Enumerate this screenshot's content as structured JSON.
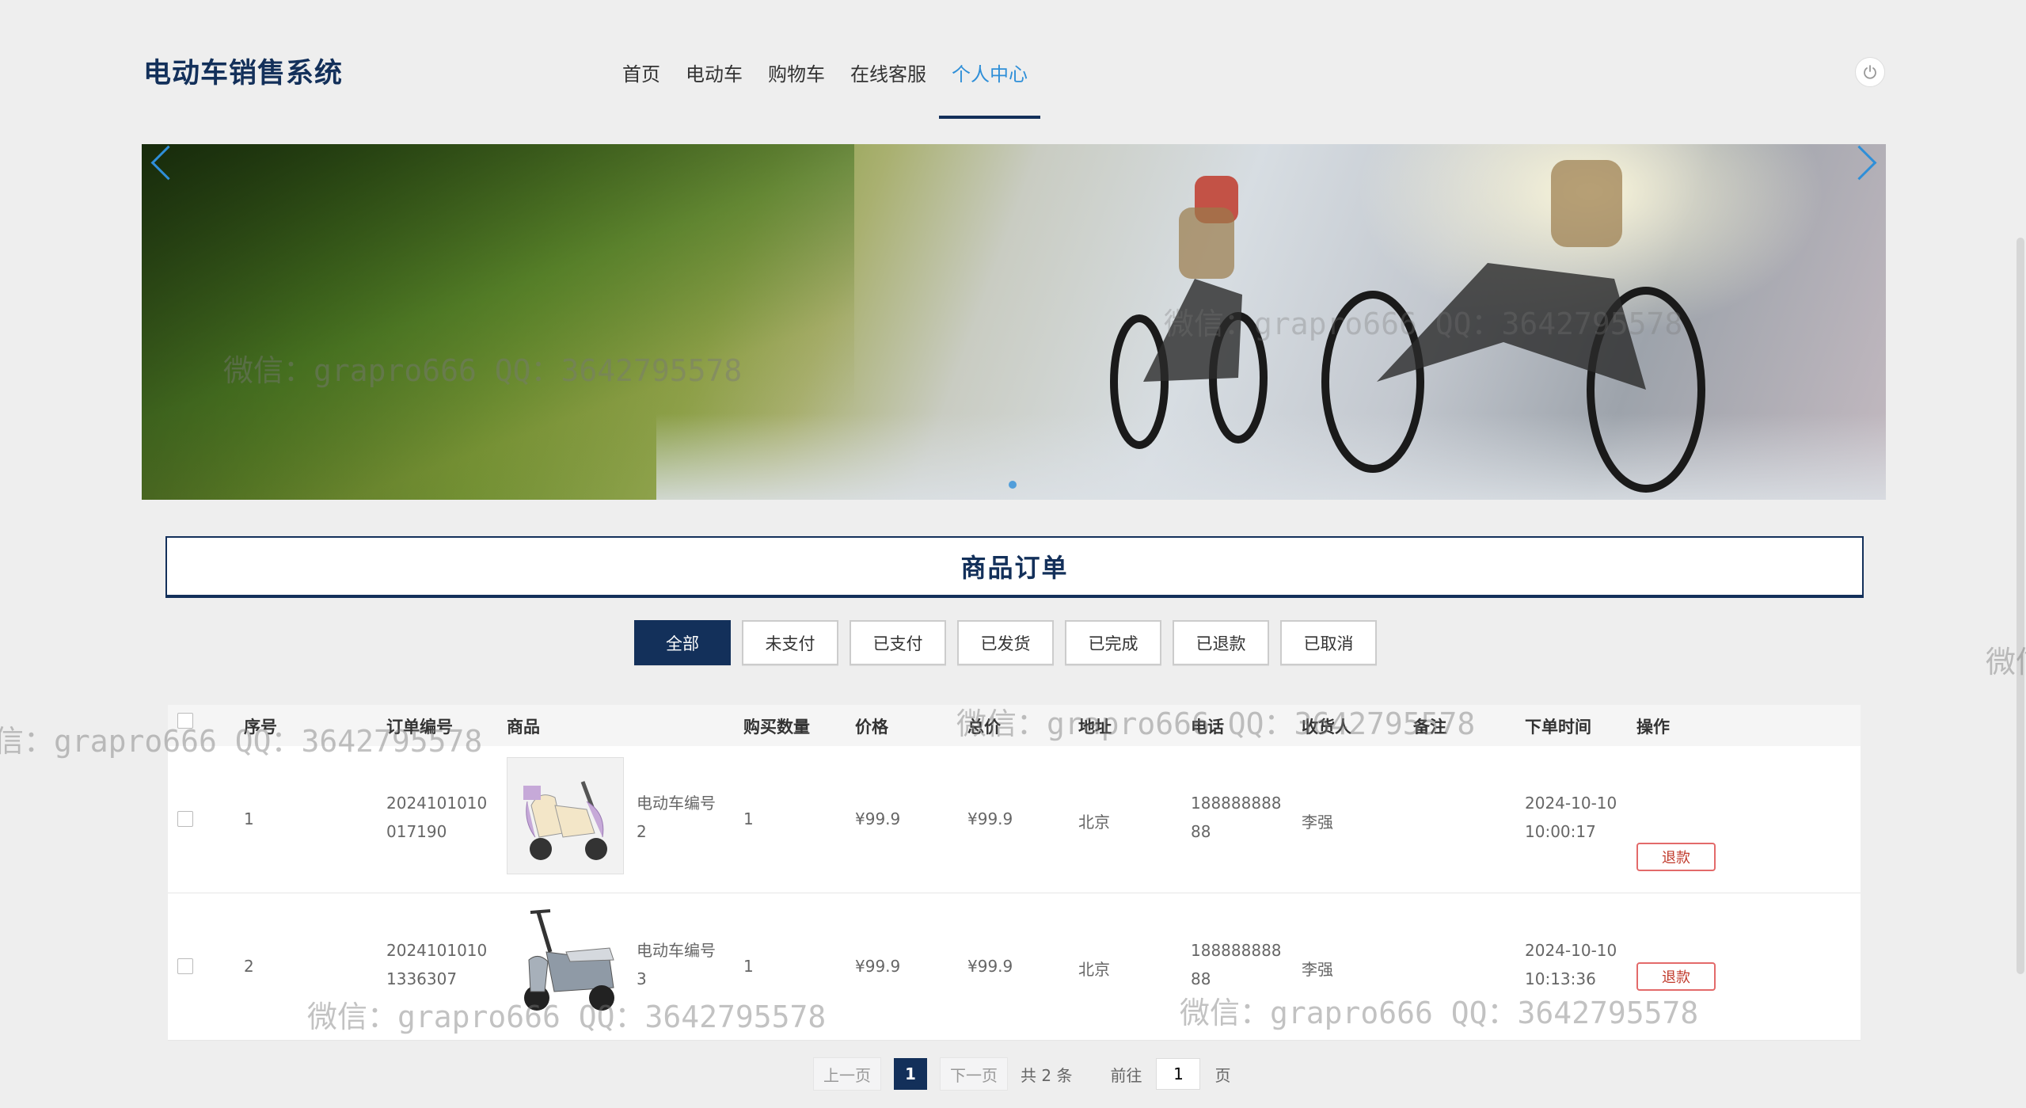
{
  "header": {
    "brand": "电动车销售系统",
    "nav": [
      {
        "label": "首页",
        "active": false
      },
      {
        "label": "电动车",
        "active": false
      },
      {
        "label": "购物车",
        "active": false
      },
      {
        "label": "在线客服",
        "active": false
      },
      {
        "label": "个人中心",
        "active": true
      }
    ],
    "power_icon": "power-icon"
  },
  "section_title": "商品订单",
  "filters": [
    {
      "label": "全部",
      "active": true
    },
    {
      "label": "未支付",
      "active": false
    },
    {
      "label": "已支付",
      "active": false
    },
    {
      "label": "已发货",
      "active": false
    },
    {
      "label": "已完成",
      "active": false
    },
    {
      "label": "已退款",
      "active": false
    },
    {
      "label": "已取消",
      "active": false
    }
  ],
  "table": {
    "columns": [
      "序号",
      "订单编号",
      "商品",
      "购买数量",
      "价格",
      "总价",
      "地址",
      "电话",
      "收货人",
      "备注",
      "下单时间",
      "操作"
    ],
    "rows": [
      {
        "index": "1",
        "order_no_1": "2024101010",
        "order_no_2": "017190",
        "product_1": "电动车编号",
        "product_2": "2",
        "qty": "1",
        "price": "¥99.9",
        "total": "¥99.9",
        "address": "北京",
        "phone_1": "188888888",
        "phone_2": "88",
        "receiver": "李强",
        "note": "",
        "time_1": "2024-10-10",
        "time_2": "10:00:17",
        "action": "退款"
      },
      {
        "index": "2",
        "order_no_1": "2024101010",
        "order_no_2": "1336307",
        "product_1": "电动车编号",
        "product_2": "3",
        "qty": "1",
        "price": "¥99.9",
        "total": "¥99.9",
        "address": "北京",
        "phone_1": "188888888",
        "phone_2": "88",
        "receiver": "李强",
        "note": "",
        "time_1": "2024-10-10",
        "time_2": "10:13:36",
        "action": "退款"
      }
    ]
  },
  "pagination": {
    "prev": "上一页",
    "current": "1",
    "next": "下一页",
    "total": "共 2 条",
    "goto": "前往",
    "goto_value": "1",
    "page_unit": "页"
  },
  "watermarks": [
    "微信：grapro666 QQ：3642795578",
    "微信：grapro666 QQ：3642795578",
    "信：grapro666 QQ：3642795578",
    "微信：grapro666 QQ：3642795578",
    "微信：grapro666 QQ：3642795578",
    "微信：grapro666 QQ：3642795578",
    "微信"
  ],
  "colors": {
    "primary": "#13305a",
    "accent": "#2f8fd8",
    "danger": "#c0392b",
    "background": "#eeeeee"
  }
}
